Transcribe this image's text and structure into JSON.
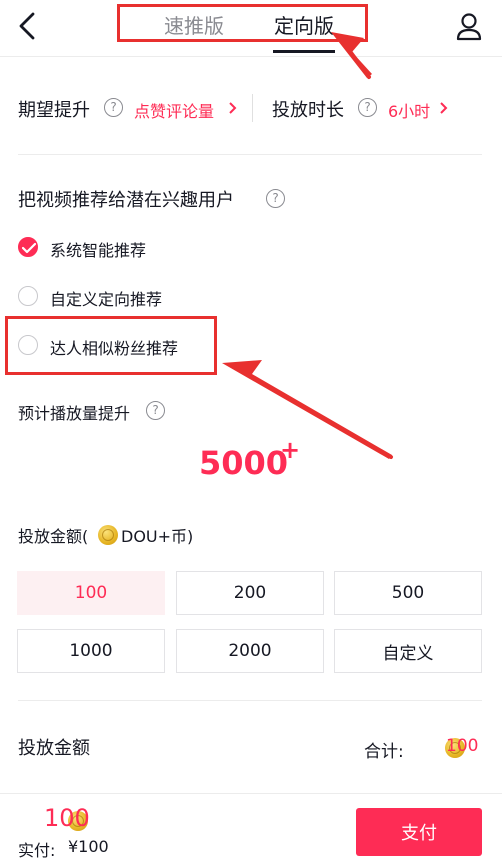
{
  "header": {
    "tab_fast": "速推版",
    "tab_target": "定向版"
  },
  "goal": {
    "label": "期望提升",
    "value": "点赞评论量",
    "duration_label": "投放时长",
    "duration_value": "6小时"
  },
  "targeting": {
    "title": "把视频推荐给潜在兴趣用户",
    "options": [
      {
        "label": "系统智能推荐",
        "checked": true
      },
      {
        "label": "自定义定向推荐",
        "checked": false
      },
      {
        "label": "达人相似粉丝推荐",
        "checked": false
      }
    ]
  },
  "forecast": {
    "label": "预计播放量提升",
    "value": "5000",
    "suffix": "+"
  },
  "amount": {
    "label_prefix": "投放金额(",
    "label_suffix": "DOU+币)",
    "options": [
      "100",
      "200",
      "500",
      "1000",
      "2000",
      "自定义"
    ],
    "selected": "100"
  },
  "total": {
    "label": "投放金额",
    "sum_label": "合计:",
    "sum_value": "100"
  },
  "footer": {
    "amount": "100",
    "paid_label": "实付:",
    "paid_value": "¥100",
    "pay_button": "支付"
  },
  "colors": {
    "accent": "#fe2c55",
    "annotation": "#e8302f"
  },
  "icons": [
    "back-arrow-icon",
    "person-icon",
    "help-icon",
    "chevron-right-icon",
    "check-icon",
    "coin-icon"
  ]
}
